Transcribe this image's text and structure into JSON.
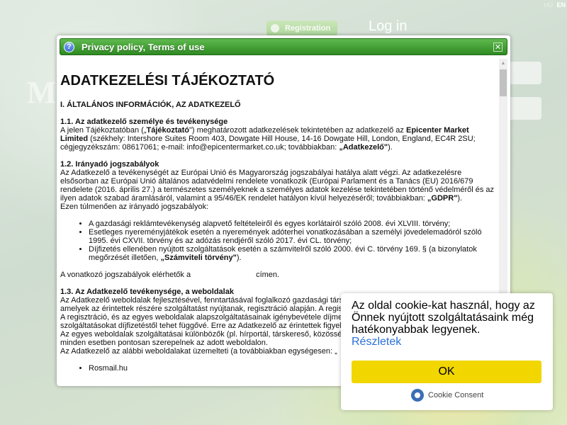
{
  "lang": {
    "hu": "HU",
    "en": "EN"
  },
  "header": {
    "register": "Registration",
    "login": "Log in",
    "bg_text": "Mi"
  },
  "dialog": {
    "title": "Privacy policy, Terms of use",
    "help_icon": "?",
    "close_icon": "✕",
    "heading": "ADATKEZELÉSI TÁJÉKOZTATÓ",
    "section1": "I. ÁLTALÁNOS INFORMÁCIÓK, AZ ADATKEZELŐ",
    "s11_title": "1.1. Az adatkezelő személye és tevékenysége",
    "s11_a": "A jelen Tájékoztatóban („",
    "s11_b": "Tájékoztató",
    "s11_c": "\") meghatározott adatkezelések tekintetében az adatkezelő az ",
    "s11_d": "Epicenter Market Limited",
    "s11_e": " (székhely: Intershore Suites Room 403, Dowgate Hill House, 14-16 Dowgate Hill, London, England, EC4R 2SU; cégjegyzékszám: 08617061; e-mail: info@epicentermarket.co.uk; továbbiakban: ",
    "s11_f": "„Adatkezelő\"",
    "s11_g": ").",
    "s12_title": "1.2. Irányadó jogszabályok",
    "s12_a": "Az Adatkezelő a tevékenységét az Európai Unió és Magyarország jogszabályai hatálya alatt végzi. Az adatkezelésre elsősorban az Európai Unió általános adatvédelmi rendelete vonatkozik (Európai Parlament és a Tanács (EU) 2016/679 rendelete (2016. április 27.) a természetes személyeknek a személyes adatok kezelése tekintetében történő védelméről és az ilyen adatok szabad áramlásáról, valamint a 95/46/EK rendelet hatályon kívül helyezéséről; továbbiakban: ",
    "s12_b": "„GDPR\"",
    "s12_c": ").",
    "s12_more": "Ezen túlmenően az irányadó jogszabályok:",
    "list": [
      "A gazdasági reklámtevékenység alapvető feltételeiről és egyes korlátairól szóló 2008. évi XLVIII. törvény;",
      "Esetleges nyereményjátékok esetén a nyeremények adóterhei vonatkozásában a személyi jövedelemadóról szóló 1995. évi CXVII. törvény és az adózás rendjéről szóló 2017. évi CL. törvény;",
      "Díjfizetés ellenében nyújtott szolgáltatások esetén a számvitelről szóló 2000. évi C. törvény 169. § (a bizonylatok megőrzését illetően, "
    ],
    "list3_bold": "„Számviteli törvény\"",
    "list3_end": ").",
    "law_link_a": "A vonatkozó jogszabályok elérhetők a",
    "law_link_b": "címen.",
    "s13_title": "1.3. Az Adatkezelő tevékenysége, a weboldalak",
    "s13_a": "Az Adatkezelő weboldalak fejlesztésével, fenntartásával foglalkozó gazdasági társaság, amely a weboldalakat fejleszt, amelyek az érintettek részére szolgáltatást nyújtanak, regisztráció alapján. A regisztrációhoz szükséges az adatok megadása. A regisztráció, és az egyes weboldalak alapszolgáltatásainak igénybevétele díjmentes, az Adatkezelő bizonyos szolgáltatásokat díjfizetéstől tehet függővé. Erre az Adatkezelő az érintettek figyelmét felhívja.",
    "s13_b": "Az egyes weboldalak szolgáltatásai különbözők (pl. hírportál, társkereső, közösségi oldal), a weboldalak szolgáltatásai minden esetben pontosan szerepelnek az adott weboldalon.",
    "s13_c": "Az Adatkezelő az alábbi weboldalakat üzemelteti (a továbbiakban egységesen: „",
    "s13_cut": "Rosmail.hu"
  },
  "cookie": {
    "message": "Az oldal cookie-kat használ, hogy az Önnek nyújtott szolgáltatásaink még hatékonyabbak legyenek.",
    "link": "Részletek",
    "ok": "OK",
    "brand": "Cookie Consent"
  },
  "colors": {
    "titlebar": "#2e8a22",
    "cookie_button": "#f1d600",
    "cookie_link": "#2a6fd8"
  }
}
